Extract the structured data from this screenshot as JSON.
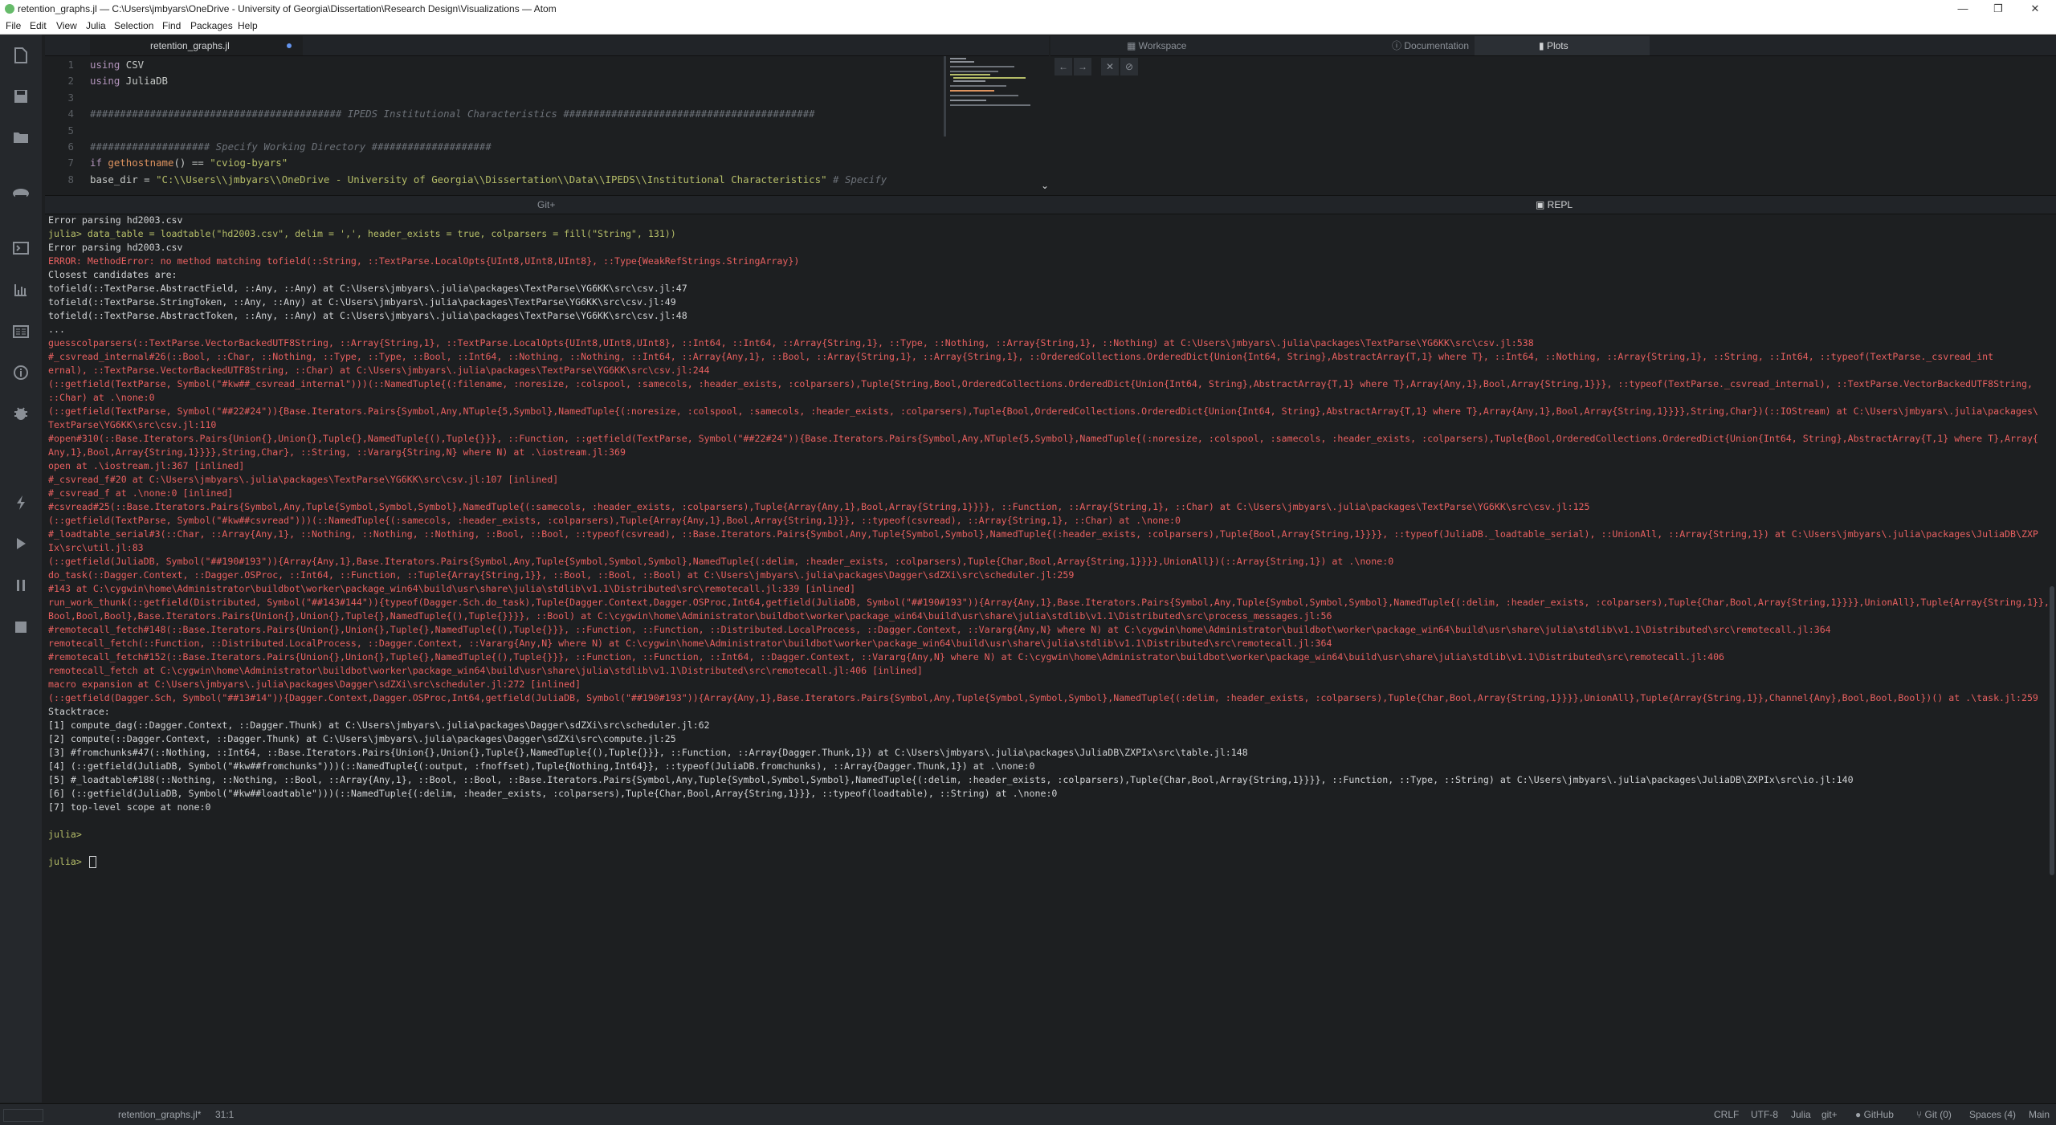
{
  "window": {
    "title": "retention_graphs.jl — C:\\Users\\jmbyars\\OneDrive - University of Georgia\\Dissertation\\Research Design\\Visualizations — Atom",
    "minimize": "—",
    "maximize": "❐",
    "close": "✕"
  },
  "menu": [
    "File",
    "Edit",
    "View",
    "Julia",
    "Selection",
    "Find",
    "Packages",
    "Help"
  ],
  "toolbar_icons": [
    "new-file-icon",
    "save-icon",
    "open-folder-icon",
    "julia-client-icon",
    "terminal-icon",
    "plot-icon",
    "docs-icon",
    "info-icon",
    "debug-icon",
    "run-icon",
    "play-icon",
    "pause-icon",
    "stop-icon"
  ],
  "editor": {
    "tab_label": "retention_graphs.jl",
    "lines": [
      {
        "n": "1",
        "parts": [
          [
            "kw",
            "using"
          ],
          [
            "",
            "CSV"
          ]
        ]
      },
      {
        "n": "2",
        "parts": [
          [
            "kw",
            "using"
          ],
          [
            "",
            "JuliaDB"
          ]
        ]
      },
      {
        "n": "3",
        "parts": []
      },
      {
        "n": "4",
        "parts": [
          [
            "cmt",
            "########################################## IPEDS Institutional Characteristics ##########################################"
          ]
        ]
      },
      {
        "n": "5",
        "parts": []
      },
      {
        "n": "6",
        "parts": [
          [
            "cmt",
            "#################### Specify Working Directory ####################"
          ]
        ]
      },
      {
        "n": "7",
        "parts": [
          [
            "kw",
            "if"
          ],
          [
            "fn",
            "gethostname"
          ],
          [
            "",
            "() == "
          ],
          [
            "str",
            "\"cviog-byars\""
          ]
        ]
      },
      {
        "n": "8",
        "parts": [
          [
            "",
            "    base_dir = "
          ],
          [
            "str",
            "\"C:\\\\Users\\\\jmbyars\\\\OneDrive - University of Georgia\\\\Dissertation\\\\Data\\\\IPEDS\\\\Institutional Characteristics\""
          ],
          [
            "cmt",
            " # Specify"
          ]
        ]
      }
    ]
  },
  "side_panel": {
    "tabs": [
      {
        "label": "Workspace",
        "icon": "workspace-icon",
        "active": false
      },
      {
        "label": "Documentation",
        "icon": "info-icon",
        "active": false
      },
      {
        "label": "Plots",
        "icon": "plot-icon",
        "active": true
      }
    ],
    "plot_controls": [
      "←",
      "→",
      "✕",
      "⊘"
    ]
  },
  "bottom_tabs": {
    "left": "Git+",
    "right": "REPL"
  },
  "repl": [
    [
      "norm",
      "Error parsing hd2003.csv"
    ],
    [
      "prompt",
      "julia> data_table = loadtable(\"hd2003.csv\", delim = ',', header_exists = true, colparsers = fill(\"String\", 131))"
    ],
    [
      "norm",
      "Error parsing hd2003.csv"
    ],
    [
      "err",
      "ERROR: MethodError: no method matching tofield(::String, ::TextParse.LocalOpts{UInt8,UInt8,UInt8}, ::Type{WeakRefStrings.StringArray})"
    ],
    [
      "norm",
      "Closest candidates are:"
    ],
    [
      "norm",
      "  tofield(::TextParse.AbstractField, ::Any, ::Any) at C:\\Users\\jmbyars\\.julia\\packages\\TextParse\\YG6KK\\src\\csv.jl:47"
    ],
    [
      "norm",
      "  tofield(::TextParse.StringToken, ::Any, ::Any) at C:\\Users\\jmbyars\\.julia\\packages\\TextParse\\YG6KK\\src\\csv.jl:49"
    ],
    [
      "norm",
      "  tofield(::TextParse.AbstractToken, ::Any, ::Any) at C:\\Users\\jmbyars\\.julia\\packages\\TextParse\\YG6KK\\src\\csv.jl:48"
    ],
    [
      "norm",
      "  ..."
    ],
    [
      "err",
      "guesscolparsers(::TextParse.VectorBackedUTF8String, ::Array{String,1}, ::TextParse.LocalOpts{UInt8,UInt8,UInt8}, ::Int64, ::Int64, ::Array{String,1}, ::Type, ::Nothing, ::Array{String,1}, ::Nothing) at C:\\Users\\jmbyars\\.julia\\packages\\TextParse\\YG6KK\\src\\csv.jl:538"
    ],
    [
      "err",
      "#_csvread_internal#26(::Bool, ::Char, ::Nothing, ::Type, ::Type, ::Bool, ::Int64, ::Nothing, ::Nothing, ::Int64, ::Array{Any,1}, ::Bool, ::Array{String,1}, ::Array{String,1}, ::OrderedCollections.OrderedDict{Union{Int64, String},AbstractArray{T,1} where T}, ::Int64, ::Nothing, ::Array{String,1}, ::String, ::Int64, ::typeof(TextParse._csvread_int"
    ],
    [
      "err",
      "ernal), ::TextParse.VectorBackedUTF8String, ::Char) at C:\\Users\\jmbyars\\.julia\\packages\\TextParse\\YG6KK\\src\\csv.jl:244"
    ],
    [
      "err",
      "(::getfield(TextParse, Symbol(\"#kw##_csvread_internal\")))(::NamedTuple{(:filename, :noresize, :colspool, :samecols, :header_exists, :colparsers),Tuple{String,Bool,OrderedCollections.OrderedDict{Union{Int64, String},AbstractArray{T,1} where T},Array{Any,1},Bool,Array{String,1}}}, ::typeof(TextParse._csvread_internal), ::TextParse.VectorBackedUTF8String,"
    ],
    [
      "err",
      "::Char) at .\\none:0"
    ],
    [
      "err",
      "(::getfield(TextParse, Symbol(\"##22#24\")){Base.Iterators.Pairs{Symbol,Any,NTuple{5,Symbol},NamedTuple{(:noresize, :colspool, :samecols, :header_exists, :colparsers),Tuple{Bool,OrderedCollections.OrderedDict{Union{Int64, String},AbstractArray{T,1} where T},Array{Any,1},Bool,Array{String,1}}}},String,Char})(::IOStream) at C:\\Users\\jmbyars\\.julia\\packages\\"
    ],
    [
      "err",
      "TextParse\\YG6KK\\src\\csv.jl:110"
    ],
    [
      "err",
      "#open#310(::Base.Iterators.Pairs{Union{},Union{},Tuple{},NamedTuple{(),Tuple{}}}, ::Function, ::getfield(TextParse, Symbol(\"##22#24\")){Base.Iterators.Pairs{Symbol,Any,NTuple{5,Symbol},NamedTuple{(:noresize, :colspool, :samecols, :header_exists, :colparsers),Tuple{Bool,OrderedCollections.OrderedDict{Union{Int64, String},AbstractArray{T,1} where T},Array{"
    ],
    [
      "err",
      "Any,1},Bool,Array{String,1}}}},String,Char}, ::String, ::Vararg{String,N} where N) at .\\iostream.jl:369"
    ],
    [
      "err",
      "open at .\\iostream.jl:367 [inlined]"
    ],
    [
      "err",
      "#_csvread_f#20 at C:\\Users\\jmbyars\\.julia\\packages\\TextParse\\YG6KK\\src\\csv.jl:107 [inlined]"
    ],
    [
      "err",
      "#_csvread_f at .\\none:0 [inlined]"
    ],
    [
      "err",
      "#csvread#25(::Base.Iterators.Pairs{Symbol,Any,Tuple{Symbol,Symbol,Symbol},NamedTuple{(:samecols, :header_exists, :colparsers),Tuple{Array{Any,1},Bool,Array{String,1}}}}, ::Function, ::Array{String,1}, ::Char) at C:\\Users\\jmbyars\\.julia\\packages\\TextParse\\YG6KK\\src\\csv.jl:125"
    ],
    [
      "err",
      "(::getfield(TextParse, Symbol(\"#kw##csvread\")))(::NamedTuple{(:samecols, :header_exists, :colparsers),Tuple{Array{Any,1},Bool,Array{String,1}}}, ::typeof(csvread), ::Array{String,1}, ::Char) at .\\none:0"
    ],
    [
      "err",
      "#_loadtable_serial#3(::Char, ::Array{Any,1}, ::Nothing, ::Nothing, ::Nothing, ::Bool, ::Bool, ::typeof(csvread), ::Base.Iterators.Pairs{Symbol,Any,Tuple{Symbol,Symbol},NamedTuple{(:header_exists, :colparsers),Tuple{Bool,Array{String,1}}}}, ::typeof(JuliaDB._loadtable_serial), ::UnionAll, ::Array{String,1}) at C:\\Users\\jmbyars\\.julia\\packages\\JuliaDB\\ZXP"
    ],
    [
      "err",
      "Ix\\src\\util.jl:83"
    ],
    [
      "err",
      "(::getfield(JuliaDB, Symbol(\"##190#193\")){Array{Any,1},Base.Iterators.Pairs{Symbol,Any,Tuple{Symbol,Symbol,Symbol},NamedTuple{(:delim, :header_exists, :colparsers),Tuple{Char,Bool,Array{String,1}}}},UnionAll})(::Array{String,1}) at .\\none:0"
    ],
    [
      "err",
      "do_task(::Dagger.Context, ::Dagger.OSProc, ::Int64, ::Function, ::Tuple{Array{String,1}}, ::Bool, ::Bool, ::Bool) at C:\\Users\\jmbyars\\.julia\\packages\\Dagger\\sdZXi\\src\\scheduler.jl:259"
    ],
    [
      "err",
      "#143 at C:\\cygwin\\home\\Administrator\\buildbot\\worker\\package_win64\\build\\usr\\share\\julia\\stdlib\\v1.1\\Distributed\\src\\remotecall.jl:339 [inlined]"
    ],
    [
      "err",
      "run_work_thunk(::getfield(Distributed, Symbol(\"##143#144\")){typeof(Dagger.Sch.do_task),Tuple{Dagger.Context,Dagger.OSProc,Int64,getfield(JuliaDB, Symbol(\"##190#193\")){Array{Any,1},Base.Iterators.Pairs{Symbol,Any,Tuple{Symbol,Symbol,Symbol},NamedTuple{(:delim, :header_exists, :colparsers),Tuple{Char,Bool,Array{String,1}}}},UnionAll},Tuple{Array{String,1}},"
    ],
    [
      "err",
      "Bool,Bool,Bool},Base.Iterators.Pairs{Union{},Union{},Tuple{},NamedTuple{(),Tuple{}}}}, ::Bool) at C:\\cygwin\\home\\Administrator\\buildbot\\worker\\package_win64\\build\\usr\\share\\julia\\stdlib\\v1.1\\Distributed\\src\\process_messages.jl:56"
    ],
    [
      "err",
      "#remotecall_fetch#148(::Base.Iterators.Pairs{Union{},Union{},Tuple{},NamedTuple{(),Tuple{}}}, ::Function, ::Function, ::Distributed.LocalProcess, ::Dagger.Context, ::Vararg{Any,N} where N) at C:\\cygwin\\home\\Administrator\\buildbot\\worker\\package_win64\\build\\usr\\share\\julia\\stdlib\\v1.1\\Distributed\\src\\remotecall.jl:364"
    ],
    [
      "err",
      "remotecall_fetch(::Function, ::Distributed.LocalProcess, ::Dagger.Context, ::Vararg{Any,N} where N) at C:\\cygwin\\home\\Administrator\\buildbot\\worker\\package_win64\\build\\usr\\share\\julia\\stdlib\\v1.1\\Distributed\\src\\remotecall.jl:364"
    ],
    [
      "err",
      "#remotecall_fetch#152(::Base.Iterators.Pairs{Union{},Union{},Tuple{},NamedTuple{(),Tuple{}}}, ::Function, ::Function, ::Int64, ::Dagger.Context, ::Vararg{Any,N} where N) at C:\\cygwin\\home\\Administrator\\buildbot\\worker\\package_win64\\build\\usr\\share\\julia\\stdlib\\v1.1\\Distributed\\src\\remotecall.jl:406"
    ],
    [
      "err",
      "remotecall_fetch at C:\\cygwin\\home\\Administrator\\buildbot\\worker\\package_win64\\build\\usr\\share\\julia\\stdlib\\v1.1\\Distributed\\src\\remotecall.jl:406 [inlined]"
    ],
    [
      "err",
      "macro expansion at C:\\Users\\jmbyars\\.julia\\packages\\Dagger\\sdZXi\\src\\scheduler.jl:272 [inlined]"
    ],
    [
      "err",
      "(::getfield(Dagger.Sch, Symbol(\"##13#14\")){Dagger.Context,Dagger.OSProc,Int64,getfield(JuliaDB, Symbol(\"##190#193\")){Array{Any,1},Base.Iterators.Pairs{Symbol,Any,Tuple{Symbol,Symbol,Symbol},NamedTuple{(:delim, :header_exists, :colparsers),Tuple{Char,Bool,Array{String,1}}}},UnionAll},Tuple{Array{String,1}},Channel{Any},Bool,Bool,Bool})() at .\\task.jl:259"
    ],
    [
      "norm",
      "Stacktrace:"
    ],
    [
      "norm",
      " [1] compute_dag(::Dagger.Context, ::Dagger.Thunk) at C:\\Users\\jmbyars\\.julia\\packages\\Dagger\\sdZXi\\src\\scheduler.jl:62"
    ],
    [
      "norm",
      " [2] compute(::Dagger.Context, ::Dagger.Thunk) at C:\\Users\\jmbyars\\.julia\\packages\\Dagger\\sdZXi\\src\\compute.jl:25"
    ],
    [
      "norm",
      " [3] #fromchunks#47(::Nothing, ::Int64, ::Base.Iterators.Pairs{Union{},Union{},Tuple{},NamedTuple{(),Tuple{}}}, ::Function, ::Array{Dagger.Thunk,1}) at C:\\Users\\jmbyars\\.julia\\packages\\JuliaDB\\ZXPIx\\src\\table.jl:148"
    ],
    [
      "norm",
      " [4] (::getfield(JuliaDB, Symbol(\"#kw##fromchunks\")))(::NamedTuple{(:output, :fnoffset),Tuple{Nothing,Int64}}, ::typeof(JuliaDB.fromchunks), ::Array{Dagger.Thunk,1}) at .\\none:0"
    ],
    [
      "norm",
      " [5] #_loadtable#188(::Nothing, ::Nothing, ::Bool, ::Array{Any,1}, ::Bool, ::Bool, ::Base.Iterators.Pairs{Symbol,Any,Tuple{Symbol,Symbol,Symbol},NamedTuple{(:delim, :header_exists, :colparsers),Tuple{Char,Bool,Array{String,1}}}}, ::Function, ::Type, ::String) at C:\\Users\\jmbyars\\.julia\\packages\\JuliaDB\\ZXPIx\\src\\io.jl:140"
    ],
    [
      "norm",
      " [6] (::getfield(JuliaDB, Symbol(\"#kw##loadtable\")))(::NamedTuple{(:delim, :header_exists, :colparsers),Tuple{Char,Bool,Array{String,1}}}, ::typeof(loadtable), ::String) at .\\none:0"
    ],
    [
      "norm",
      " [7] top-level scope at none:0"
    ],
    [
      "norm",
      ""
    ],
    [
      "prompt",
      "julia>"
    ],
    [
      "norm",
      ""
    ],
    [
      "prompt",
      "julia> "
    ]
  ],
  "status": {
    "file": "retention_graphs.jl*",
    "cursor": "31:1",
    "line_ending": "CRLF",
    "encoding": "UTF-8",
    "grammar": "Julia",
    "git_plus": "git+",
    "github": "GitHub",
    "git": "Git (0)",
    "indent": "Spaces (4)",
    "module": "Main"
  }
}
